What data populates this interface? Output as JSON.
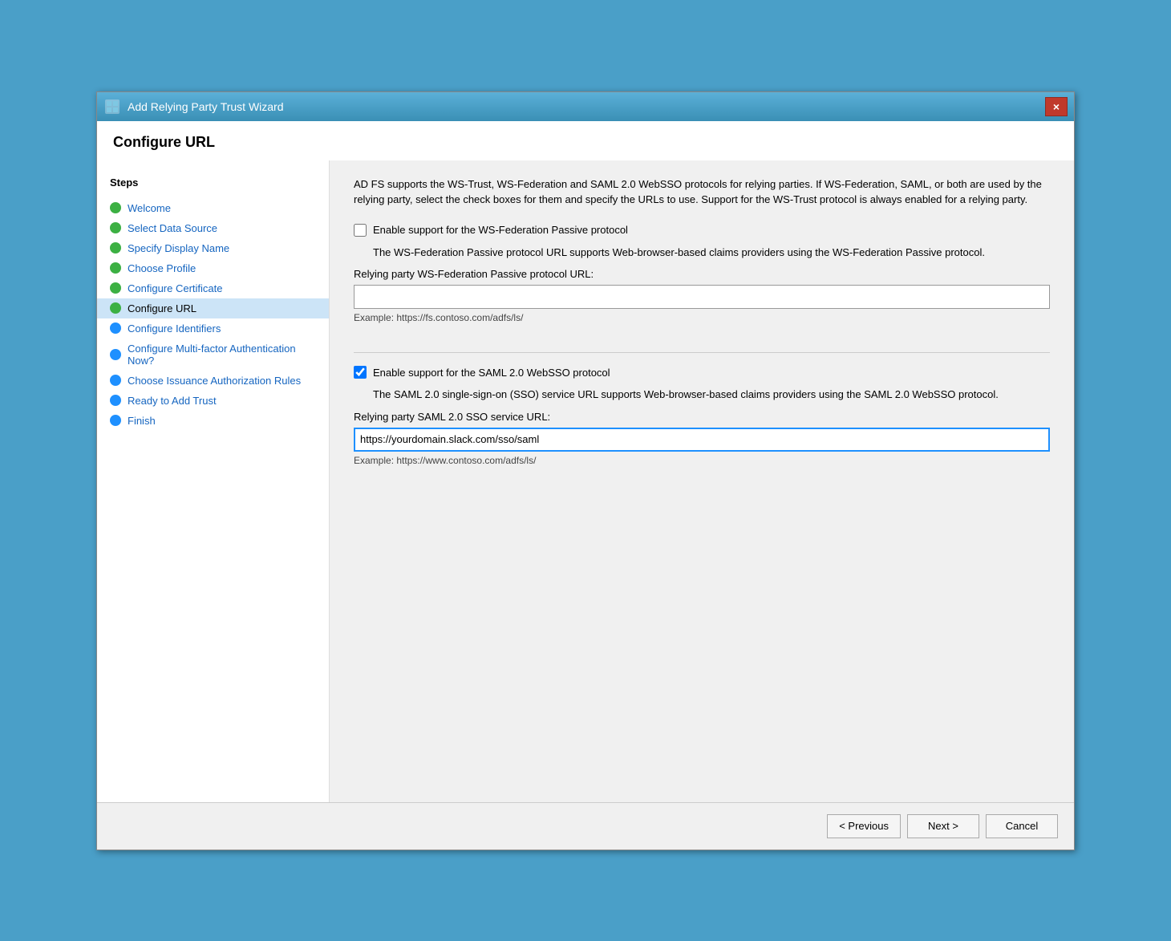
{
  "window": {
    "title": "Add Relying Party Trust Wizard",
    "close_label": "×"
  },
  "page": {
    "title": "Configure URL"
  },
  "sidebar": {
    "steps_label": "Steps",
    "items": [
      {
        "id": "welcome",
        "label": "Welcome",
        "dot": "green",
        "active": false
      },
      {
        "id": "select-data-source",
        "label": "Select Data Source",
        "dot": "green",
        "active": false
      },
      {
        "id": "specify-display-name",
        "label": "Specify Display Name",
        "dot": "green",
        "active": false
      },
      {
        "id": "choose-profile",
        "label": "Choose Profile",
        "dot": "green",
        "active": false
      },
      {
        "id": "configure-certificate",
        "label": "Configure Certificate",
        "dot": "green",
        "active": false
      },
      {
        "id": "configure-url",
        "label": "Configure URL",
        "dot": "green",
        "active": true
      },
      {
        "id": "configure-identifiers",
        "label": "Configure Identifiers",
        "dot": "blue",
        "active": false
      },
      {
        "id": "configure-multifactor",
        "label": "Configure Multi-factor Authentication Now?",
        "dot": "blue",
        "active": false
      },
      {
        "id": "choose-issuance",
        "label": "Choose Issuance Authorization Rules",
        "dot": "blue",
        "active": false
      },
      {
        "id": "ready-to-add",
        "label": "Ready to Add Trust",
        "dot": "blue",
        "active": false
      },
      {
        "id": "finish",
        "label": "Finish",
        "dot": "blue",
        "active": false
      }
    ]
  },
  "main": {
    "description": "AD FS supports the WS-Trust, WS-Federation and SAML 2.0 WebSSO protocols for relying parties.  If WS-Federation, SAML, or both are used by the relying party, select the check boxes for them and specify the URLs to use.  Support for the WS-Trust protocol is always enabled for a relying party.",
    "ws_federation": {
      "checkbox_label": "Enable support for the WS-Federation Passive protocol",
      "checked": false,
      "description": "The WS-Federation Passive protocol URL supports Web-browser-based claims providers using the WS-Federation Passive protocol.",
      "field_label": "Relying party WS-Federation Passive protocol URL:",
      "field_value": "",
      "example": "Example: https://fs.contoso.com/adfs/ls/"
    },
    "saml": {
      "checkbox_label": "Enable support for the SAML 2.0 WebSSO protocol",
      "checked": true,
      "description": "The SAML 2.0 single-sign-on (SSO) service URL supports Web-browser-based claims providers using the SAML 2.0 WebSSO protocol.",
      "field_label": "Relying party SAML 2.0 SSO service URL:",
      "field_value": "https://yourdomain.slack.com/sso/saml",
      "example": "Example: https://www.contoso.com/adfs/ls/"
    }
  },
  "footer": {
    "previous_label": "< Previous",
    "next_label": "Next >",
    "cancel_label": "Cancel"
  }
}
